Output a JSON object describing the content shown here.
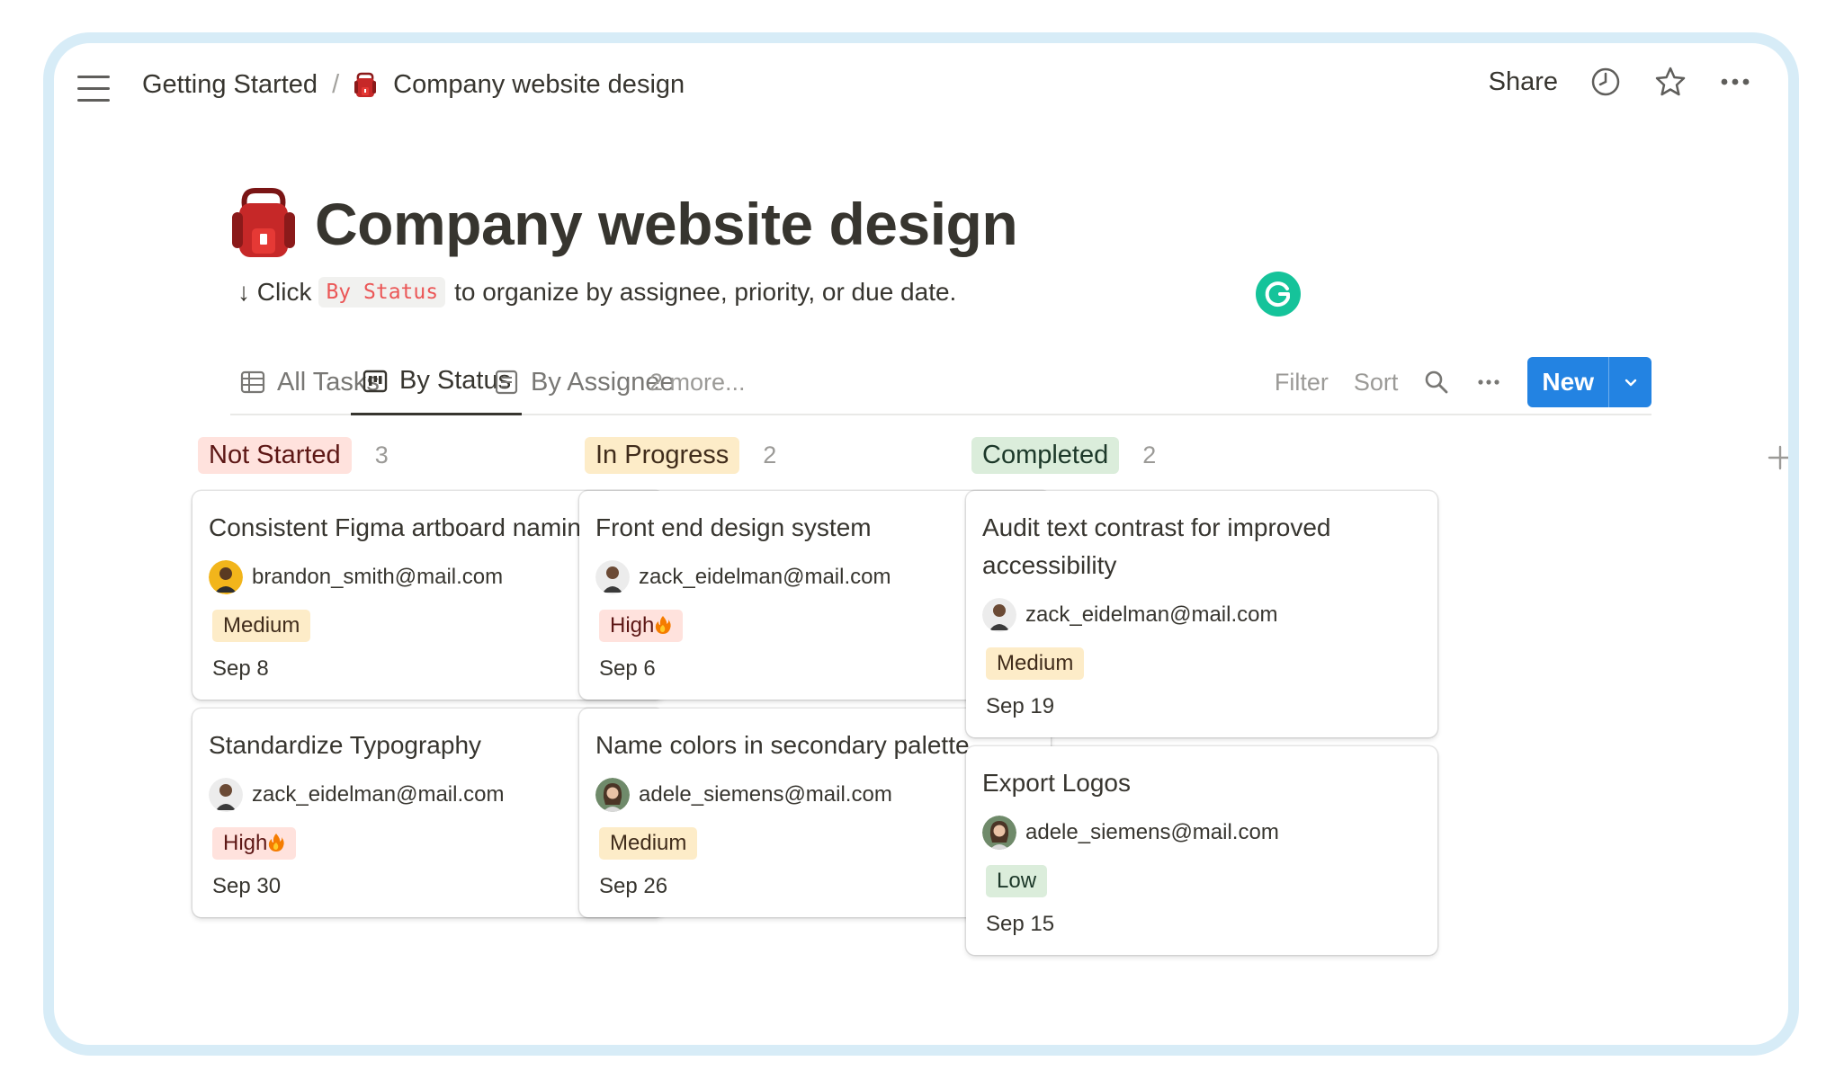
{
  "breadcrumb": {
    "parent": "Getting Started",
    "separator": "/",
    "current": "Company website design"
  },
  "header_actions": {
    "share": "Share",
    "icons": [
      "clock-icon",
      "star-icon",
      "more-horizontal-icon"
    ]
  },
  "page": {
    "title": "Company website design",
    "emoji": "red-backpack-icon",
    "hint_prefix": "↓ Click",
    "hint_code": "By Status",
    "hint_suffix": "to organize by assignee, priority, or due date."
  },
  "tabs": [
    {
      "label": "All Tasks",
      "icon": "table-icon",
      "active": false
    },
    {
      "label": "By Status",
      "icon": "board-icon",
      "active": true
    },
    {
      "label": "By Assignee",
      "icon": "list-icon",
      "active": false
    }
  ],
  "tabs_more": "2 more...",
  "toolbar": {
    "filter": "Filter",
    "sort": "Sort",
    "new": "New"
  },
  "colors": {
    "accent": "#2383e2",
    "not_started_bg": "#ffe2dd",
    "in_progress_bg": "#fdecc8",
    "completed_bg": "#dbeddb",
    "grammarly": "#15c39a"
  },
  "columns": [
    {
      "status": "Not Started",
      "count": "3",
      "cards": [
        {
          "title": "Consistent Figma artboard naming",
          "assignee": "brandon_smith@mail.com",
          "priority": "Medium",
          "due": "Sep 8"
        },
        {
          "title": "Standardize Typography",
          "assignee": "zack_eidelman@mail.com",
          "priority": "High",
          "due": "Sep 30"
        }
      ]
    },
    {
      "status": "In Progress",
      "count": "2",
      "cards": [
        {
          "title": "Front end design system",
          "assignee": "zack_eidelman@mail.com",
          "priority": "High",
          "due": "Sep 6"
        },
        {
          "title": "Name colors in secondary palette",
          "assignee": "adele_siemens@mail.com",
          "priority": "Medium",
          "due": "Sep 26"
        }
      ]
    },
    {
      "status": "Completed",
      "count": "2",
      "cards": [
        {
          "title": "Audit text contrast for improved accessibility",
          "assignee": "zack_eidelman@mail.com",
          "priority": "Medium",
          "due": "Sep 19"
        },
        {
          "title": "Export Logos",
          "assignee": "adele_siemens@mail.com",
          "priority": "Low",
          "due": "Sep 15"
        }
      ]
    }
  ]
}
